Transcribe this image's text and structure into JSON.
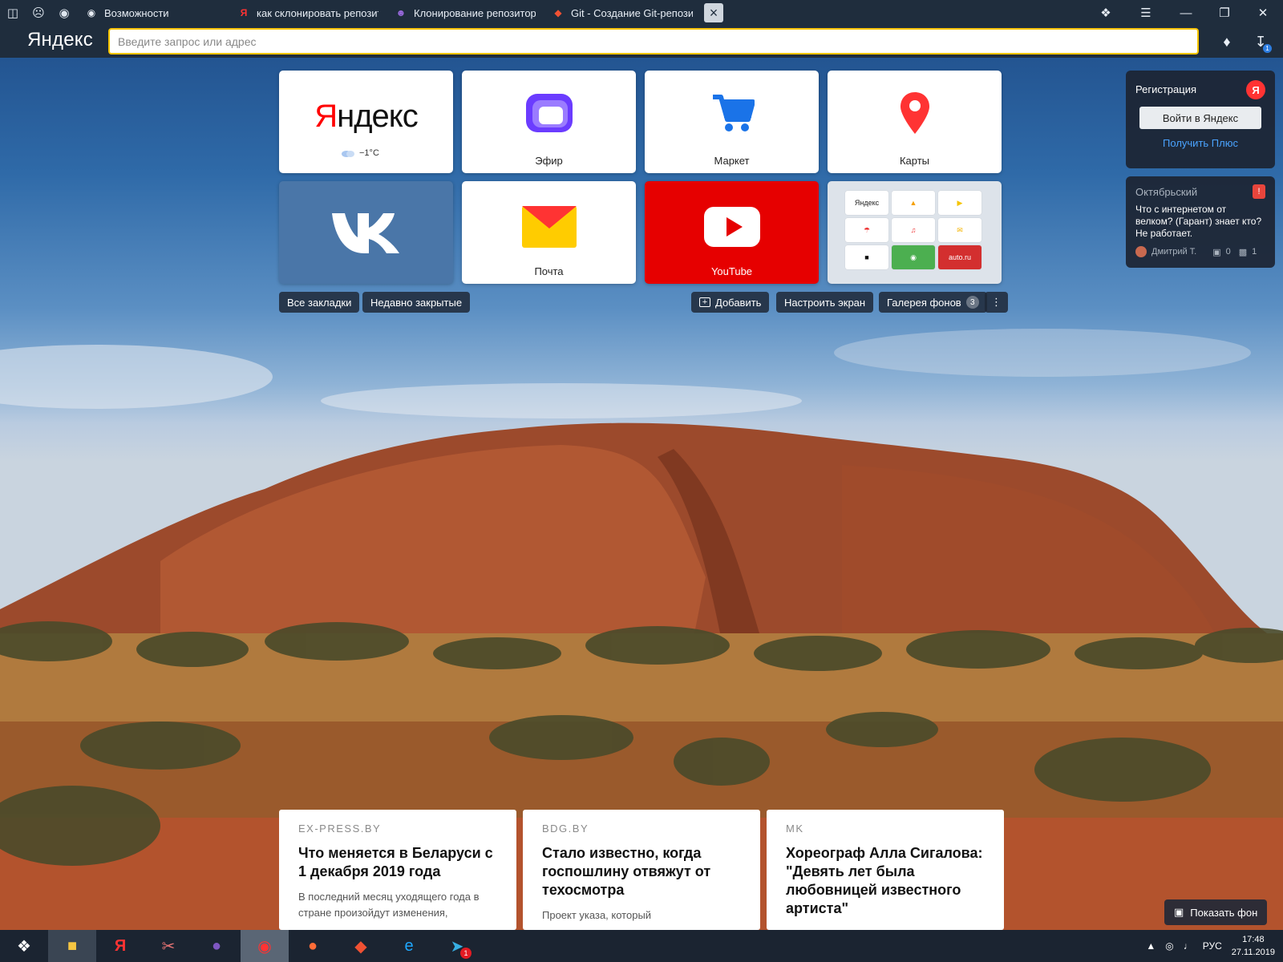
{
  "tabs": [
    {
      "title": "Возможности",
      "icon": "github-icon"
    },
    {
      "title": "как склонировать репозит",
      "icon": "yandex-icon"
    },
    {
      "title": "Клонирование репозитор",
      "icon": "devcats-icon"
    },
    {
      "title": "Git - Создание Git-репозит",
      "icon": "git-icon"
    }
  ],
  "addressbar": {
    "logo": "Яндекс",
    "placeholder": "Введите запрос или адрес"
  },
  "speed_dial": {
    "tiles": [
      {
        "label": "",
        "logo": "Яндекс",
        "weather": "−1°C"
      },
      {
        "label": "Эфир"
      },
      {
        "label": "Маркет"
      },
      {
        "label": "Карты"
      },
      {
        "label": "",
        "icon": "vk-icon"
      },
      {
        "label": "Почта"
      },
      {
        "label": "YouTube"
      },
      {
        "label": "",
        "folder": [
          "Яндекс",
          "",
          "",
          "",
          "",
          "",
          "",
          "",
          "auto.ru"
        ]
      }
    ],
    "buttons": {
      "all_bookmarks": "Все закладки",
      "recently_closed": "Недавно закрытые",
      "add": "Добавить",
      "customize": "Настроить экран",
      "gallery": "Галерея фонов",
      "gallery_count": "3"
    }
  },
  "account_panel": {
    "title": "Регистрация",
    "login": "Войти в Яндекс",
    "plus": "Получить Плюс"
  },
  "district_panel": {
    "title": "Октябрьский",
    "text": "Что с интернетом от велком? (Гарант) знает кто? Не работает.",
    "author": "Дмитрий Т.",
    "photos": "0",
    "comments": "1"
  },
  "news": [
    {
      "source": "EX-PRESS.BY",
      "headline": "Что меняется в Беларуси с 1 декабря 2019 года",
      "desc": "В последний месяц уходящего года в стране произойдут изменения,"
    },
    {
      "source": "BDG.BY",
      "headline": "Стало известно, когда госпошлину отвяжут от техосмотра",
      "desc": "Проект указа, который"
    },
    {
      "source": "MK",
      "headline": "Хореограф Алла Сигалова: \"Девять лет была любовницей известного артиста\"",
      "desc": ""
    }
  ],
  "show_bg": "Показать фон",
  "tray": {
    "lang": "РУС",
    "time": "17:48",
    "date": "27.11.2019",
    "telegram_badge": "1",
    "download_badge": "1"
  },
  "colors": {
    "yandex_red": "#ff0000",
    "input_border": "#f8c400",
    "youtube_red": "#e60000",
    "link_blue": "#4aa3ff",
    "chrome_dark": "#1f2d3d"
  }
}
